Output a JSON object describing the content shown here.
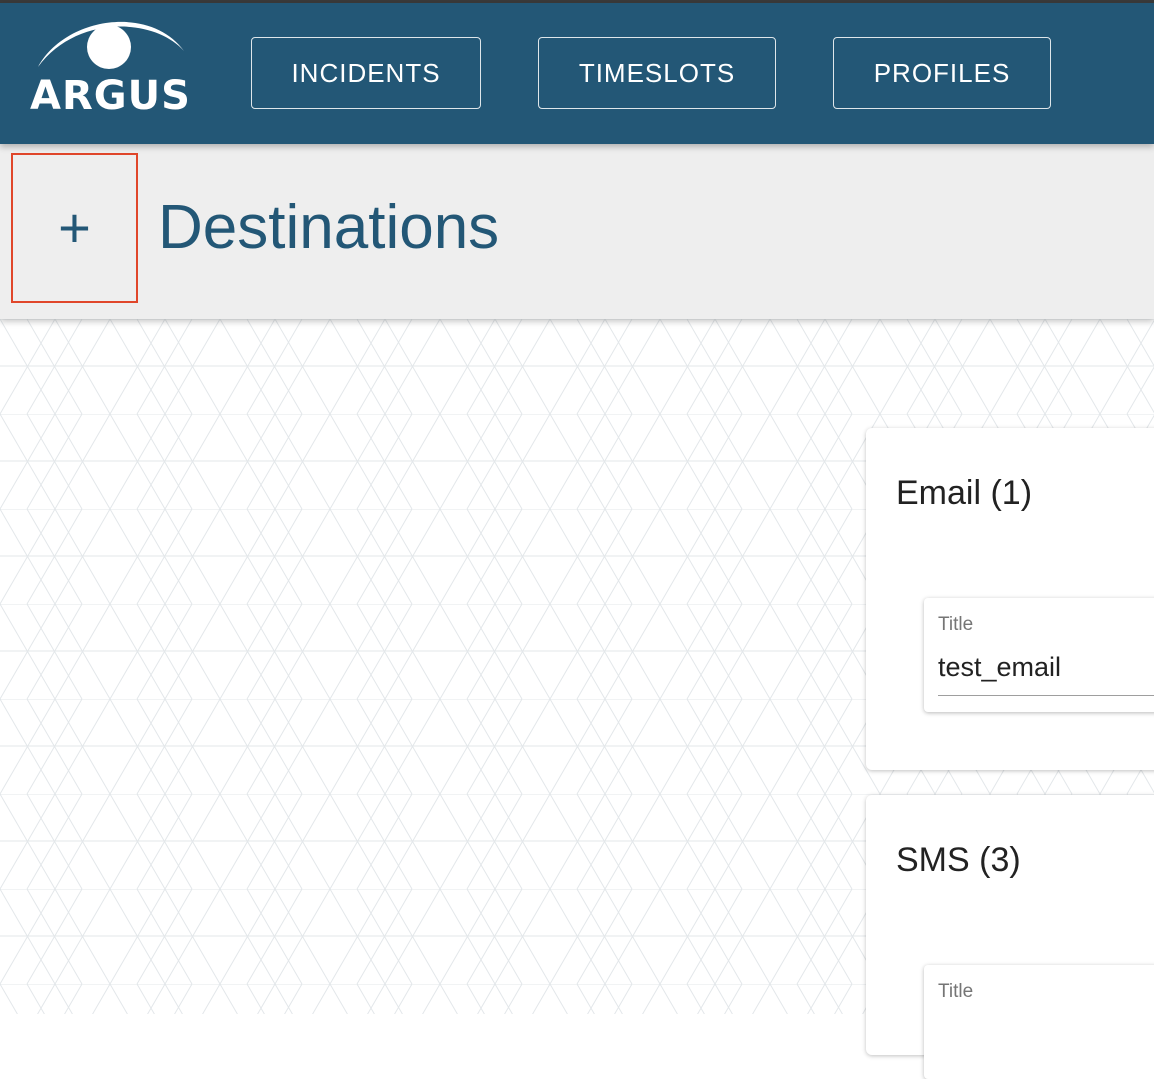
{
  "app": {
    "logo_text": "ARGUS",
    "colors": {
      "primary": "#235776",
      "header_bg": "#eeeeee",
      "highlight": "#e0462a"
    }
  },
  "nav": {
    "items": [
      {
        "label": "INCIDENTS"
      },
      {
        "label": "TIMESLOTS"
      },
      {
        "label": "PROFILES"
      }
    ]
  },
  "header": {
    "add_label": "+",
    "add_icon": "plus-icon",
    "title": "Destinations"
  },
  "destinations": [
    {
      "title": "Email (1)",
      "field": {
        "label": "Title",
        "value": "test_email"
      }
    },
    {
      "title": "SMS (3)",
      "field": {
        "label": "Title",
        "value": ""
      }
    }
  ]
}
